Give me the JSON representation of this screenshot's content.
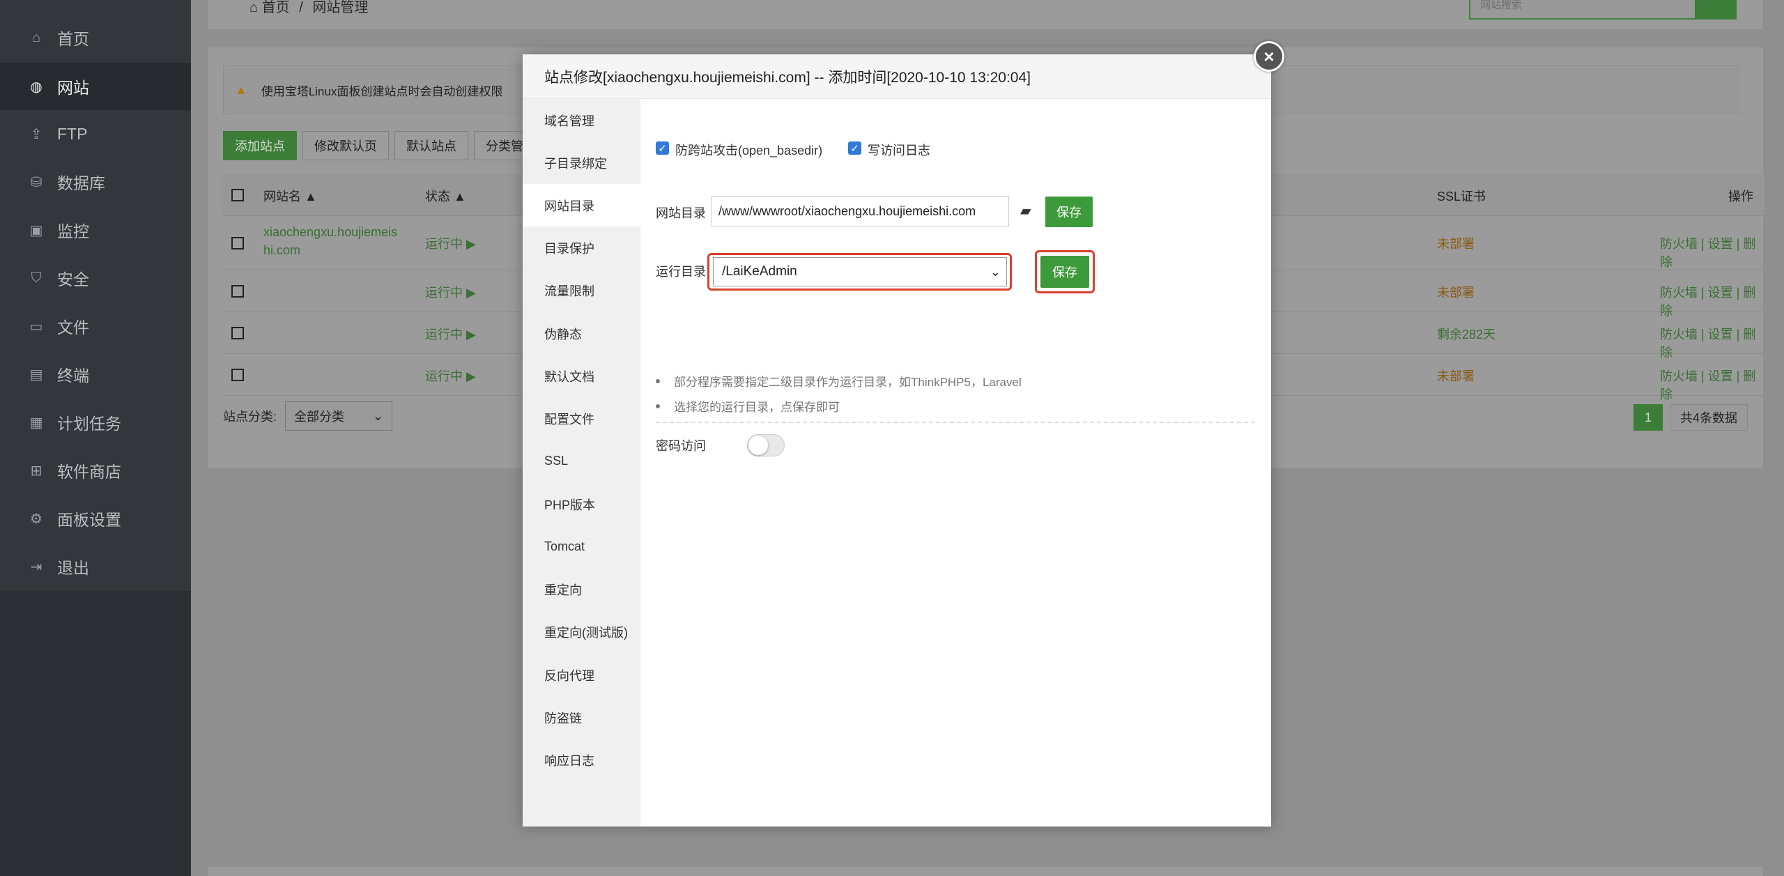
{
  "sidebar": {
    "items": [
      {
        "label": "首页",
        "icon": "home-icon"
      },
      {
        "label": "网站",
        "icon": "globe-icon",
        "active": true
      },
      {
        "label": "FTP",
        "icon": "ftp-icon"
      },
      {
        "label": "数据库",
        "icon": "database-icon"
      },
      {
        "label": "监控",
        "icon": "monitor-icon"
      },
      {
        "label": "安全",
        "icon": "shield-icon"
      },
      {
        "label": "文件",
        "icon": "folder-icon"
      },
      {
        "label": "终端",
        "icon": "terminal-icon"
      },
      {
        "label": "计划任务",
        "icon": "calendar-icon"
      },
      {
        "label": "软件商店",
        "icon": "grid-icon"
      },
      {
        "label": "面板设置",
        "icon": "gear-icon"
      },
      {
        "label": "退出",
        "icon": "logout-icon"
      }
    ]
  },
  "header": {
    "breadcrumb_home": "首页",
    "breadcrumb_sep": "/",
    "breadcrumb_current": "网站管理",
    "search_placeholder": "网站搜索"
  },
  "site_list": {
    "alert": "使用宝塔Linux面板创建站点时会自动创建权限",
    "buttons": {
      "add_site": "添加站点",
      "modify_default": "修改默认页",
      "default_site": "默认站点",
      "category": "分类管"
    },
    "columns": {
      "name": "网站名",
      "status": "状态",
      "ssl": "SSL证书",
      "ops": "操作"
    },
    "rows": [
      {
        "name": "xiaochengxu.houjiemeis\nhi.com",
        "status": "运行中 ▶",
        "ssl": "未部署",
        "ops": "防火墙 | 设置 | 删除"
      },
      {
        "name": "",
        "status": "运行中 ▶",
        "ssl": "未部署",
        "ops": "防火墙 | 设置 | 删除"
      },
      {
        "name": "",
        "status": "运行中 ▶",
        "ssl": "剩余282天",
        "ops": "防火墙 | 设置 | 删除"
      },
      {
        "name": "",
        "status": "运行中 ▶",
        "ssl": "未部署",
        "ops": "防火墙 | 设置 | 删除"
      }
    ],
    "filter_label": "站点分类:",
    "filter_value": "全部分类",
    "page": "1",
    "total": "共4条数据"
  },
  "modal": {
    "title": "站点修改[xiaochengxu.houjiemeishi.com] -- 添加时间[2020-10-10 13:20:04]",
    "tabs": [
      "域名管理",
      "子目录绑定",
      "网站目录",
      "目录保护",
      "流量限制",
      "伪静态",
      "默认文档",
      "配置文件",
      "SSL",
      "PHP版本",
      "Tomcat",
      "重定向",
      "重定向(测试版)",
      "反向代理",
      "防盗链",
      "响应日志"
    ],
    "active_tab": "网站目录",
    "checkbox_openbasedir": "防跨站攻击(open_basedir)",
    "checkbox_log": "写访问日志",
    "site_dir_label": "网站目录",
    "site_dir_value": "/www/wwwroot/xiaochengxu.houjiemeishi.com",
    "save_label": "保存",
    "run_dir_label": "运行目录",
    "run_dir_value": "/LaiKeAdmin",
    "tip1": "部分程序需要指定二级目录作为运行目录，如ThinkPHP5，Laravel",
    "tip2": "选择您的运行目录，点保存即可",
    "password_label": "密码访问"
  }
}
